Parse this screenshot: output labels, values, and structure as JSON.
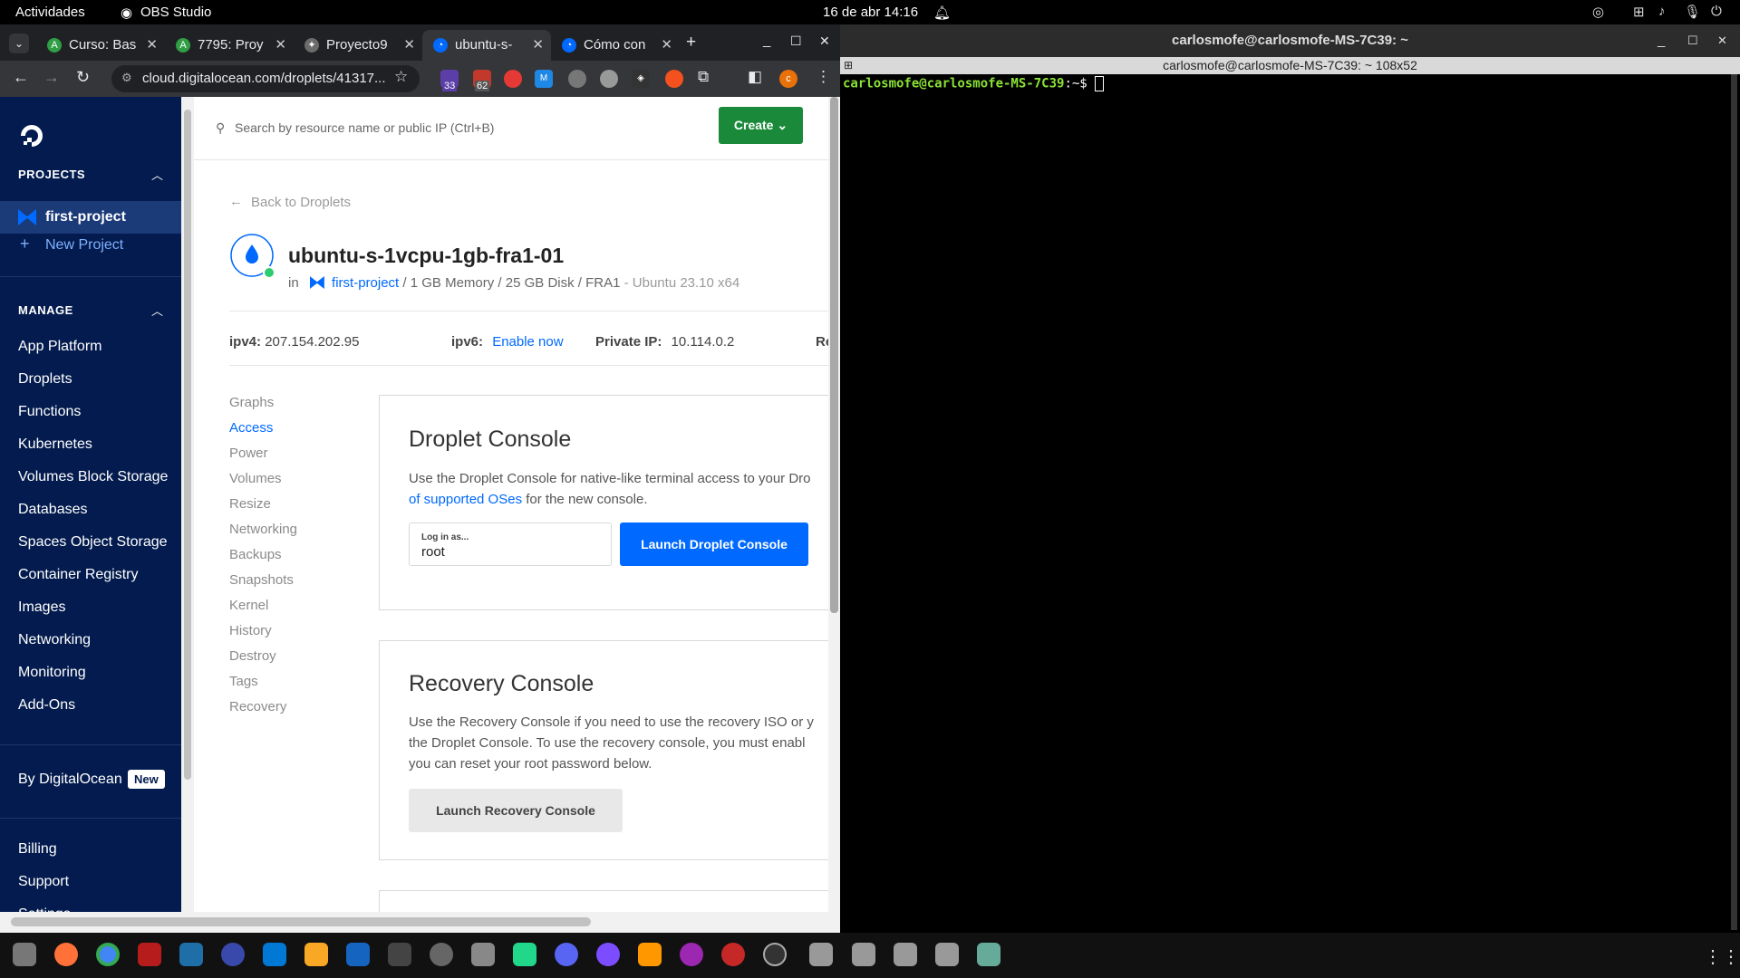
{
  "topbar": {
    "activities": "Actividades",
    "app": "OBS Studio",
    "clock": "16 de abr  14:16"
  },
  "chrome": {
    "tabs": [
      {
        "label": "Curso: Bas",
        "color": "#2f9e44"
      },
      {
        "label": "7795: Proy",
        "color": "#2f9e44"
      },
      {
        "label": "Proyecto9",
        "color": "#6b6b6b"
      },
      {
        "label": "ubuntu-s-",
        "color": "#0069ff"
      },
      {
        "label": "Cómo con",
        "color": "#0069ff"
      }
    ],
    "url": "cloud.digitalocean.com/droplets/41317...",
    "badges": {
      "a": "33",
      "b": "62"
    }
  },
  "sidebar": {
    "projects_heading": "PROJECTS",
    "active_project": "first-project",
    "new_project": "New Project",
    "manage_heading": "MANAGE",
    "manage_items": [
      "App Platform",
      "Droplets",
      "Functions",
      "Kubernetes",
      "Volumes Block Storage",
      "Databases",
      "Spaces Object Storage",
      "Container Registry",
      "Images",
      "Networking",
      "Monitoring",
      "Add-Ons"
    ],
    "by_do": "By DigitalOcean",
    "new_badge": "New",
    "bottom_items": [
      "Billing",
      "Support",
      "Settings"
    ]
  },
  "search": {
    "placeholder": "Search by resource name or public IP (Ctrl+B)",
    "create": "Create"
  },
  "droplet": {
    "back": "Back to Droplets",
    "name": "ubuntu-s-1vcpu-1gb-fra1-01",
    "in": "in",
    "project": "first-project",
    "specs": "/ 1 GB Memory / 25 GB Disk / FRA1",
    "os": "- Ubuntu 23.10 x64",
    "ipv4_label": "ipv4:",
    "ipv4": "207.154.202.95",
    "ipv6_label": "ipv6:",
    "ipv6_action": "Enable now",
    "private_label": "Private IP:",
    "private_ip": "10.114.0.2",
    "reserved_cut": "Re"
  },
  "subnav": [
    "Graphs",
    "Access",
    "Power",
    "Volumes",
    "Resize",
    "Networking",
    "Backups",
    "Snapshots",
    "Kernel",
    "History",
    "Destroy",
    "Tags",
    "Recovery"
  ],
  "droplet_console": {
    "title": "Droplet Console",
    "desc1": "Use the Droplet Console for native-like terminal access to your Dro",
    "desc2_link": "of supported OSes",
    "desc2_rest": " for the new console.",
    "login_label": "Log in as...",
    "login_value": "root",
    "button": "Launch Droplet Console"
  },
  "recovery_console": {
    "title": "Recovery Console",
    "desc1": "Use the Recovery Console if you need to use the recovery ISO or y",
    "desc2": "the Droplet Console. To use the recovery console, you must enabl",
    "desc3": "you can reset your root password below.",
    "button": "Launch Recovery Console"
  },
  "terminal": {
    "title": "carlosmofe@carlosmofe-MS-7C39: ~",
    "subtitle": "carlosmofe@carlosmofe-MS-7C39: ~ 108x52",
    "prompt_user": "carlosmofe@carlosmofe-MS-7C39",
    "prompt_path": ":~$ "
  },
  "colors": {
    "do_navy": "#031b4e",
    "do_blue": "#0069ff",
    "create_green": "#1a8a3a",
    "terminal_green": "#8ae234"
  }
}
